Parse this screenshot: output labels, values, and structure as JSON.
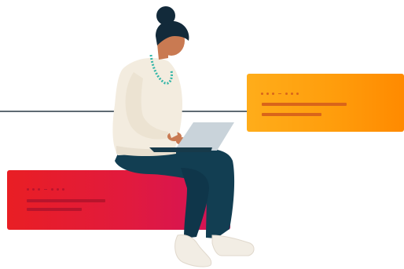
{
  "scene": {
    "description_alt": "",
    "colors": {
      "line": "#5e6a73",
      "orange_card": "#ff9d0c",
      "red_card": "#e11a3e",
      "sweater": "#f3ecdf",
      "pants": "#123e52",
      "skin": "#c97a52",
      "hair": "#122a3a",
      "necklace": "#35b6a8",
      "laptop": "#c9d3da",
      "shoes": "#f2ede4"
    },
    "icons": [
      "woman-with-laptop-illustration"
    ]
  },
  "cards": {
    "orange": {
      "placeholder_dots": "••• - •••"
    },
    "red": {
      "placeholder_dots": "••• - •••"
    }
  }
}
